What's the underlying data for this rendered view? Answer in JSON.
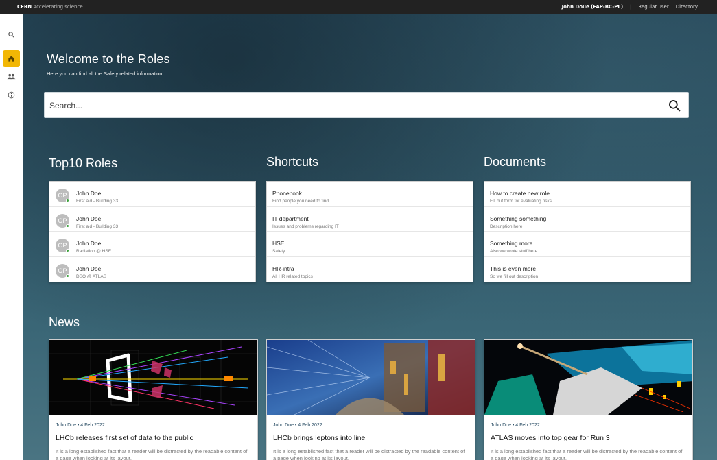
{
  "topbar": {
    "brand_bold": "CERN",
    "brand_rest": "Accelerating science",
    "user": "John Doue (FAP-BC-PL)",
    "separator": "|",
    "role": "Regular user",
    "directory": "Directory"
  },
  "sidebar": {
    "items": [
      {
        "icon": "search-icon",
        "active": false
      },
      {
        "icon": "home-icon",
        "active": true
      },
      {
        "icon": "people-icon",
        "active": false
      },
      {
        "icon": "info-icon",
        "active": false
      }
    ],
    "active_color": "#f2b705"
  },
  "hero": {
    "title": "Welcome to the Roles",
    "subtitle": "Here you can find all the Safety related information."
  },
  "search": {
    "placeholder": "Search..."
  },
  "sections": {
    "roles_title": "Top10 Roles",
    "shortcuts_title": "Shortcuts",
    "documents_title": "Documents",
    "news_title": "News"
  },
  "roles": [
    {
      "initials": "OP",
      "name": "John Doe",
      "detail": "First aid - Building 33"
    },
    {
      "initials": "OP",
      "name": "John Doe",
      "detail": "First aid - Building 33"
    },
    {
      "initials": "OP",
      "name": "John Doe",
      "detail": "Radiation @ HSE"
    },
    {
      "initials": "OP",
      "name": "John Doe",
      "detail": "DSO @ ATLAS"
    }
  ],
  "shortcuts": [
    {
      "title": "Phonebook",
      "detail": "Find people you need to find"
    },
    {
      "title": "IT department",
      "detail": "Issues and problems regarding IT"
    },
    {
      "title": "HSE",
      "detail": "Safety"
    },
    {
      "title": "HR-intra",
      "detail": "All HR related topics"
    }
  ],
  "documents": [
    {
      "title": "How to create new role",
      "detail": "Fill out form for evaluating risks"
    },
    {
      "title": "Something something",
      "detail": "Description here"
    },
    {
      "title": "Something more",
      "detail": "Also we wrote stuff here"
    },
    {
      "title": "This is even more",
      "detail": "So we fill out description"
    }
  ],
  "news": [
    {
      "meta": "John Doe • 4 Feb 2022",
      "title": "LHCb releases first set of data to the public",
      "body": "It is a long established fact that a reader will be distracted by the readable content of a page when looking at its layout."
    },
    {
      "meta": "John Doe • 4 Feb 2022",
      "title": "LHCb brings leptons into line",
      "body": "It is a long established fact that a reader will be distracted by the readable content of a page when looking at its layout."
    },
    {
      "meta": "John Doe • 4 Feb 2022",
      "title": "ATLAS moves into top gear for Run 3",
      "body": "It is a long established fact that a reader will be distracted by the readable content of a page when looking at its layout."
    }
  ]
}
